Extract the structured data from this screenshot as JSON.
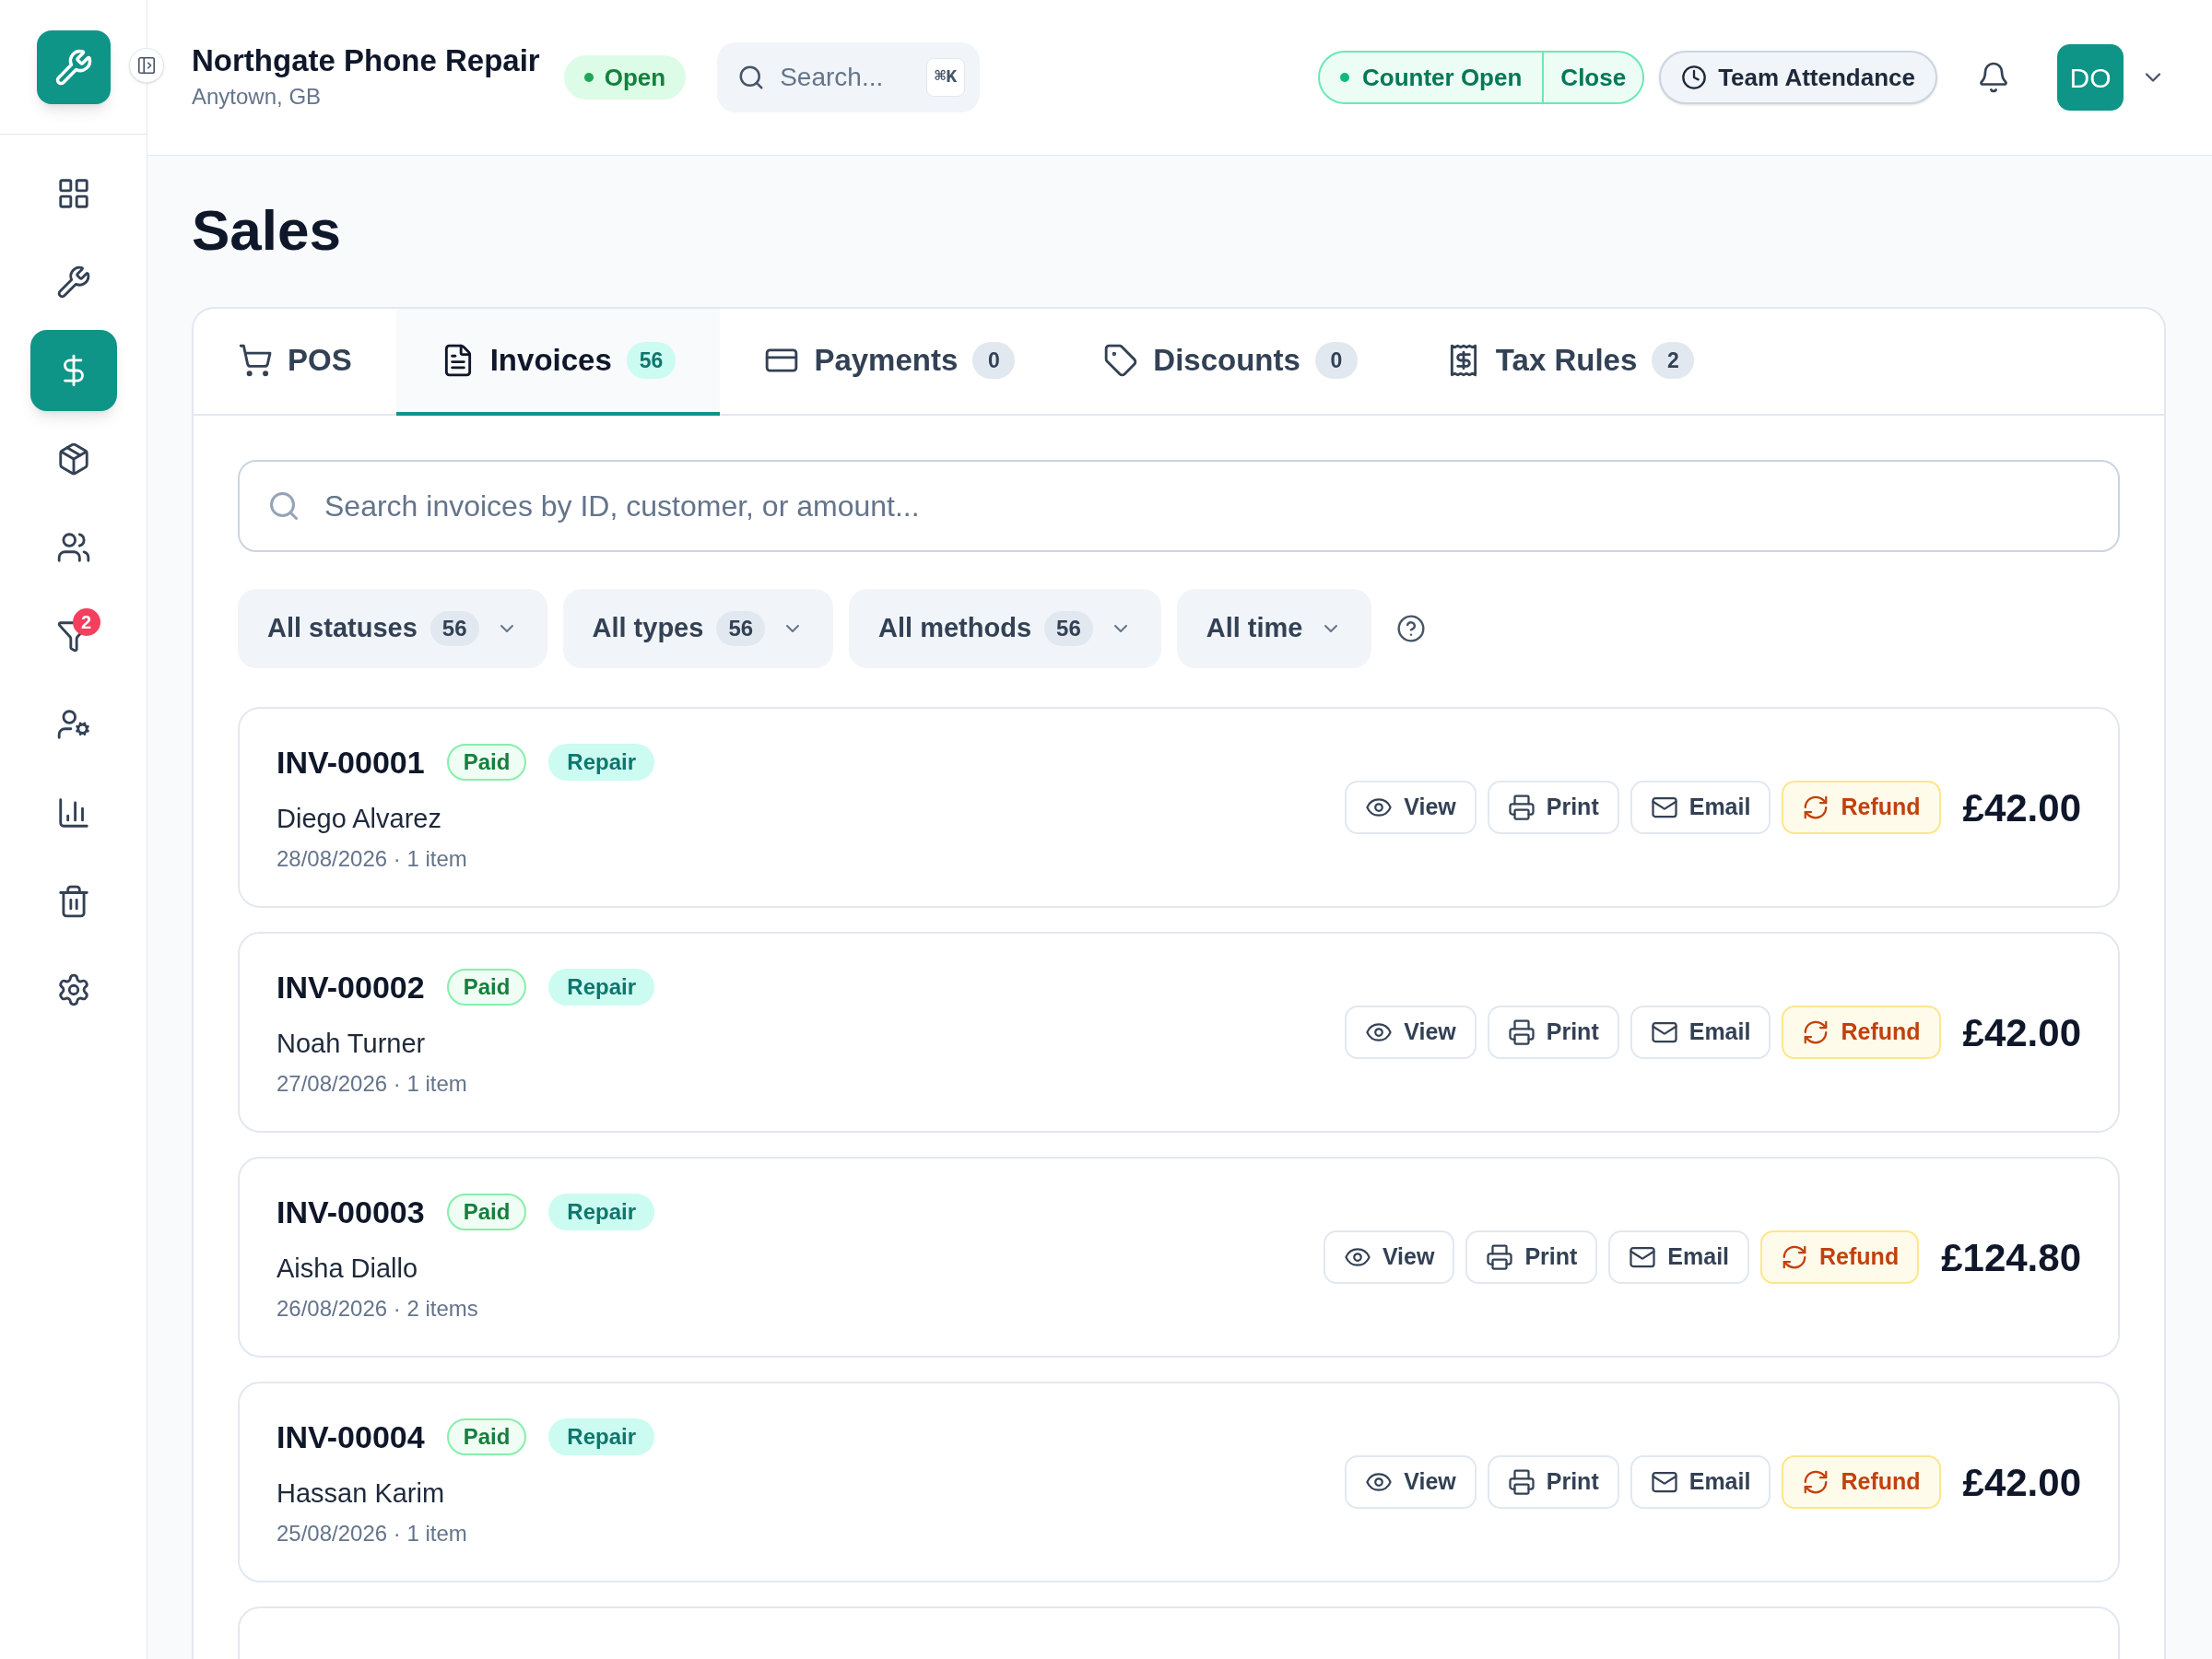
{
  "header": {
    "business_name": "Northgate Phone Repair",
    "location": "Anytown, GB",
    "status": {
      "label": "Open",
      "on": true
    },
    "search": {
      "placeholder": "Search...",
      "shortcut": "⌘K"
    },
    "counter": {
      "label": "Counter Open",
      "action": "Close"
    },
    "attendance": "Team Attendance",
    "avatar": "DO"
  },
  "sidebar": {
    "items": [
      {
        "selected": false
      },
      {
        "selected": false
      },
      {
        "selected": true
      },
      {
        "selected": false
      },
      {
        "selected": false
      },
      {
        "selected": false,
        "badge": "2"
      },
      {
        "selected": false
      },
      {
        "selected": false
      },
      {
        "selected": false
      },
      {
        "selected": false
      }
    ]
  },
  "page_title": "Sales",
  "tabs": [
    {
      "label": "POS",
      "selected": false
    },
    {
      "label": "Invoices",
      "count": "56",
      "selected": true
    },
    {
      "label": "Payments",
      "count": "0",
      "selected": false
    },
    {
      "label": "Discounts",
      "count": "0",
      "selected": false
    },
    {
      "label": "Tax Rules",
      "count": "2",
      "selected": false
    }
  ],
  "search": {
    "placeholder": "Search invoices by ID, customer, or amount..."
  },
  "filters": [
    {
      "label": "All statuses",
      "count": "56"
    },
    {
      "label": "All types",
      "count": "56"
    },
    {
      "label": "All methods",
      "count": "56"
    },
    {
      "label": "All time"
    }
  ],
  "invoices": [
    {
      "id": "INV-00001",
      "status": "Paid",
      "type": "Repair",
      "customer": "Diego Alvarez",
      "meta": "28/08/2026 · 1 item",
      "amount": "£42.00",
      "actions": [
        {
          "label": "View",
          "kind": "view"
        },
        {
          "label": "Print",
          "kind": "print"
        },
        {
          "label": "Email",
          "kind": "email"
        },
        {
          "label": "Refund",
          "kind": "refund"
        }
      ]
    },
    {
      "id": "INV-00002",
      "status": "Paid",
      "type": "Repair",
      "customer": "Noah Turner",
      "meta": "27/08/2026 · 1 item",
      "amount": "£42.00",
      "actions": [
        {
          "label": "View",
          "kind": "view"
        },
        {
          "label": "Print",
          "kind": "print"
        },
        {
          "label": "Email",
          "kind": "email"
        },
        {
          "label": "Refund",
          "kind": "refund"
        }
      ]
    },
    {
      "id": "INV-00003",
      "status": "Paid",
      "type": "Repair",
      "customer": "Aisha Diallo",
      "meta": "26/08/2026 · 2 items",
      "amount": "£124.80",
      "actions": [
        {
          "label": "View",
          "kind": "view"
        },
        {
          "label": "Print",
          "kind": "print"
        },
        {
          "label": "Email",
          "kind": "email"
        },
        {
          "label": "Refund",
          "kind": "refund"
        }
      ]
    },
    {
      "id": "INV-00004",
      "status": "Paid",
      "type": "Repair",
      "customer": "Hassan Karim",
      "meta": "25/08/2026 · 1 item",
      "amount": "£42.00",
      "actions": [
        {
          "label": "View",
          "kind": "view"
        },
        {
          "label": "Print",
          "kind": "print"
        },
        {
          "label": "Email",
          "kind": "email"
        },
        {
          "label": "Refund",
          "kind": "refund"
        }
      ]
    }
  ]
}
